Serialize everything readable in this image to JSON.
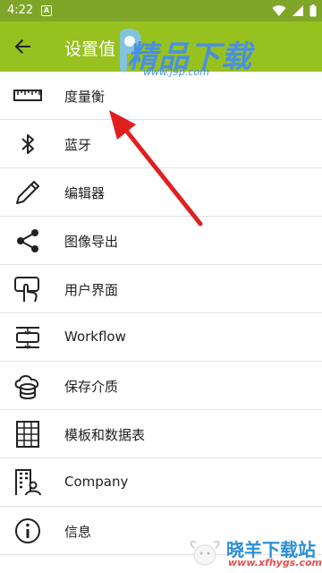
{
  "status_bar": {
    "time": "4:22",
    "notification_badge": "A"
  },
  "app_bar": {
    "title": "设置值"
  },
  "menu": {
    "items": [
      {
        "label": "度量衡",
        "icon": "ruler-icon"
      },
      {
        "label": "蓝牙",
        "icon": "bluetooth-icon"
      },
      {
        "label": "编辑器",
        "icon": "pencil-icon"
      },
      {
        "label": "图像导出",
        "icon": "share-icon"
      },
      {
        "label": "用户界面",
        "icon": "touch-screen-icon"
      },
      {
        "label": "Workflow",
        "icon": "workflow-icon"
      },
      {
        "label": "保存介质",
        "icon": "cloud-storage-icon"
      },
      {
        "label": "模板和数据表",
        "icon": "table-grid-icon"
      },
      {
        "label": "Company",
        "icon": "company-icon"
      },
      {
        "label": "信息",
        "icon": "info-icon"
      }
    ]
  },
  "watermark_top": {
    "text": "精品下载",
    "url": "www.j9p.com"
  },
  "watermark_bottom": {
    "text": "晓羊下载站",
    "url": "www.xfhygs.com"
  },
  "colors": {
    "status_bar": "#7fa628",
    "app_bar": "#97c11f",
    "arrow": "#e02020"
  }
}
